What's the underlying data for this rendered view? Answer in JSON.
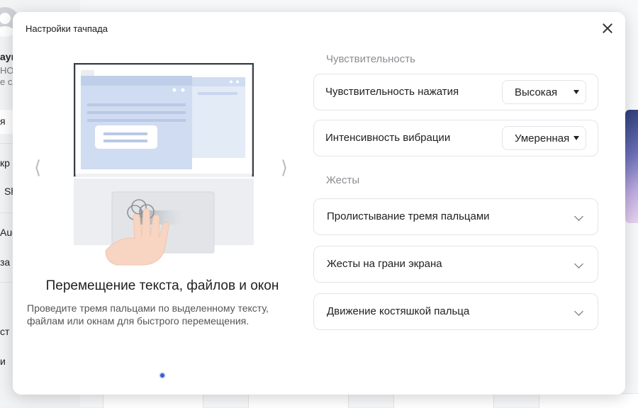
{
  "background": {
    "sidebar_fragments": [
      "аyı",
      "НОN",
      "е сл",
      "я",
      "кр",
      "Sh",
      "Aud",
      "за",
      "ст",
      "и"
    ]
  },
  "modal": {
    "title": "Настройки тачпада",
    "slide": {
      "title": "Перемещение текста, файлов и окон",
      "description": "Проведите тремя пальцами по выделенному тексту, файлам или окнам для быстрого перемещения.",
      "prev_glyph": "⟨",
      "next_glyph": "⟩"
    },
    "sensitivity": {
      "heading": "Чувствительность",
      "rows": [
        {
          "label": "Чувствительность нажатия",
          "value": "Высокая"
        },
        {
          "label": "Интенсивность вибрации",
          "value": "Умеренная"
        }
      ]
    },
    "gestures": {
      "heading": "Жесты",
      "rows": [
        {
          "label": "Пролистывание тремя пальцами"
        },
        {
          "label": "Жесты на грани экрана"
        },
        {
          "label": "Движение костяшкой пальца"
        }
      ]
    }
  },
  "colors": {
    "accent": "#3b5bd6",
    "window_primary": "#cfdcf1",
    "window_secondary": "#e3ebf7"
  }
}
